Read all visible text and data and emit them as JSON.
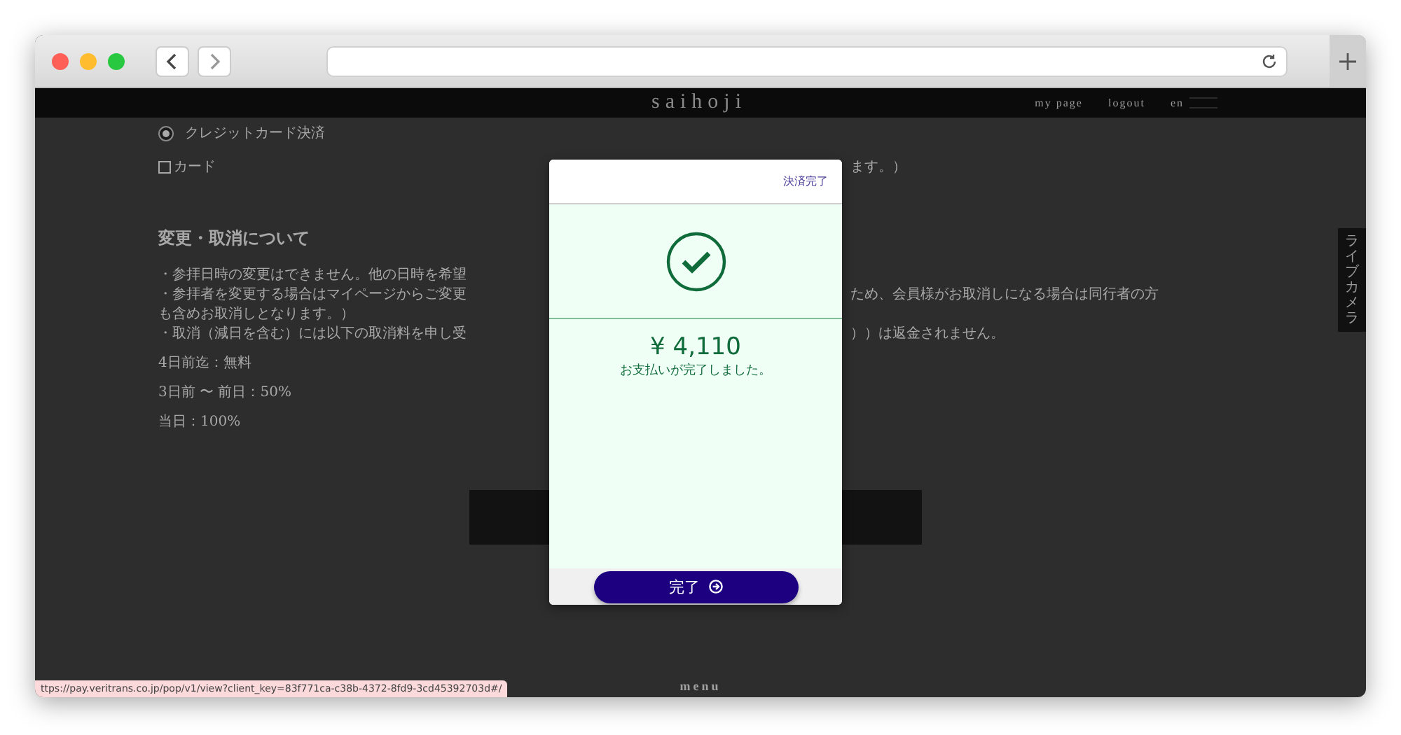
{
  "site_header": {
    "logo": "saihoji",
    "nav": [
      "my page",
      "logout",
      "en"
    ]
  },
  "payment_method": {
    "label": "クレジットカード決済",
    "selected": true
  },
  "card_option": {
    "label": "カード",
    "checked": false,
    "trailing": "ます。）"
  },
  "cancellation": {
    "heading": "変更・取消について",
    "lines": [
      {
        "left": "・参拝日時の変更はできません。他の日時を希望"
      },
      {
        "left": "・参拝者を変更する場合はマイページからご変更",
        "right": "ため、会員様がお取消しになる場合は同行者の方"
      },
      {
        "left": "も含めお取消しとなります。）"
      },
      {
        "left": "・取消（減日を含む）には以下の取消料を申し受",
        "right": "））は返金されません。"
      }
    ],
    "fees": [
      "4日前迄：無料",
      "3日前 〜 前日：50%",
      "当日：100%"
    ]
  },
  "side_tab": {
    "label": "ライブカメラ"
  },
  "footer": {
    "menu": "menu"
  },
  "status_url": "ttps://pay.veritrans.co.jp/pop/v1/view?client_key=83f771ca-c38b-4372-8fd9-3cd45392703d#/",
  "modal": {
    "title": "決済完了",
    "amount": "¥ 4,110",
    "message": "お支払いが完了しました。",
    "button": "完了"
  }
}
